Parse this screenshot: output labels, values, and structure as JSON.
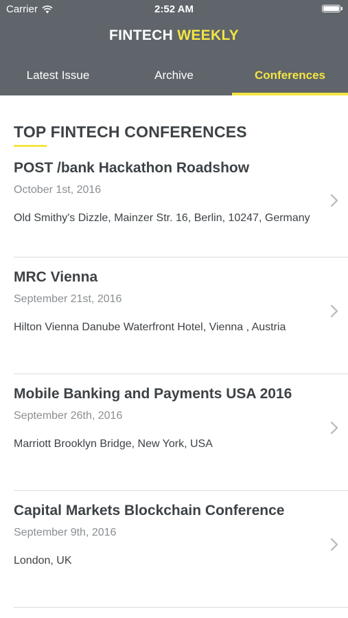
{
  "status_bar": {
    "carrier": "Carrier",
    "time": "2:52 AM"
  },
  "header": {
    "title_main": "FINTECH",
    "title_accent": "WEEKLY"
  },
  "tabs": [
    {
      "label": "Latest Issue",
      "active": false
    },
    {
      "label": "Archive",
      "active": false
    },
    {
      "label": "Conferences",
      "active": true
    }
  ],
  "section": {
    "title": "TOP FINTECH CONFERENCES"
  },
  "conferences": [
    {
      "name": "POST /bank Hackathon Roadshow",
      "date": "October 1st, 2016",
      "location": "Old Smithy's Dizzle, Mainzer Str. 16, Berlin, 10247, Germany"
    },
    {
      "name": "MRC Vienna",
      "date": "September 21st, 2016",
      "location": "Hilton Vienna Danube Waterfront Hotel, Vienna , Austria"
    },
    {
      "name": "Mobile Banking and Payments USA 2016",
      "date": "September 26th, 2016",
      "location": "Marriott Brooklyn Bridge, New York, USA"
    },
    {
      "name": "Capital Markets Blockchain Conference",
      "date": "September 9th, 2016",
      "location": "London, UK"
    }
  ],
  "icons": {
    "wifi": "wifi-icon",
    "battery": "battery-icon",
    "chevron": "chevron-right-icon"
  },
  "colors": {
    "header_bg": "#5f656b",
    "accent": "#f4e542",
    "text_dark": "#3d4246",
    "text_muted": "#8a8e92"
  }
}
